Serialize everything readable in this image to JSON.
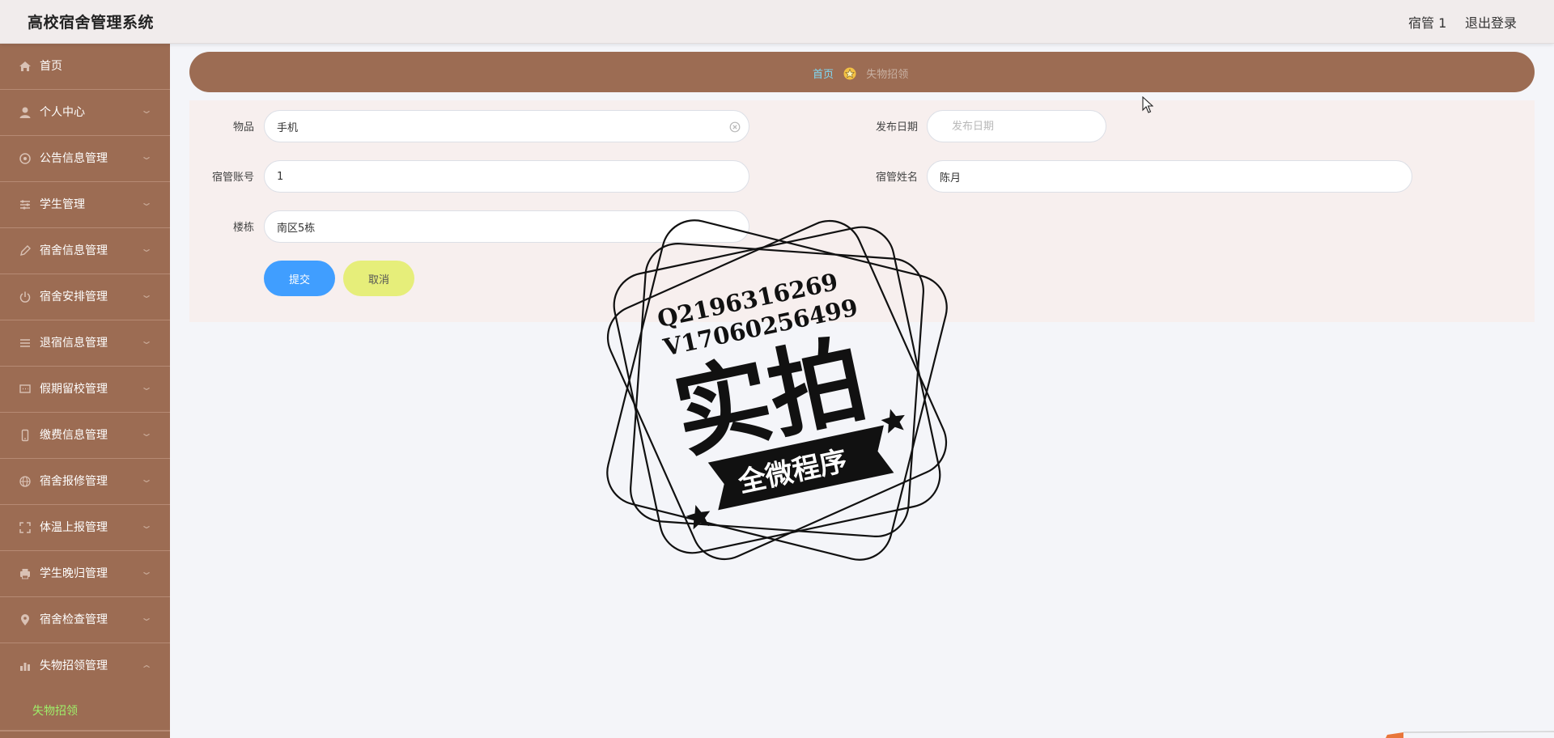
{
  "header": {
    "app_title": "高校宿舍管理系统",
    "user_name": "宿管 1",
    "logout_label": "退出登录"
  },
  "sidebar": {
    "items": [
      {
        "label": "首页",
        "icon": "home-icon",
        "has_arrow": false
      },
      {
        "label": "个人中心",
        "icon": "user-icon",
        "has_arrow": true
      },
      {
        "label": "公告信息管理",
        "icon": "bullhorn-icon",
        "has_arrow": true
      },
      {
        "label": "学生管理",
        "icon": "sliders-icon",
        "has_arrow": true
      },
      {
        "label": "宿舍信息管理",
        "icon": "edit-icon",
        "has_arrow": true
      },
      {
        "label": "宿舍安排管理",
        "icon": "power-icon",
        "has_arrow": true
      },
      {
        "label": "退宿信息管理",
        "icon": "list-icon",
        "has_arrow": true
      },
      {
        "label": "假期留校管理",
        "icon": "chat-icon",
        "has_arrow": true
      },
      {
        "label": "缴费信息管理",
        "icon": "mobile-icon",
        "has_arrow": true
      },
      {
        "label": "宿舍报修管理",
        "icon": "globe-icon",
        "has_arrow": true
      },
      {
        "label": "体温上报管理",
        "icon": "fullscreen-icon",
        "has_arrow": true
      },
      {
        "label": "学生晚归管理",
        "icon": "printer-icon",
        "has_arrow": true
      },
      {
        "label": "宿舍检查管理",
        "icon": "location-icon",
        "has_arrow": true
      },
      {
        "label": "失物招领管理",
        "icon": "bar-chart-icon",
        "has_arrow": true
      }
    ],
    "active_sub_item": "失物招领"
  },
  "breadcrumb": {
    "home": "首页",
    "current": "失物招领"
  },
  "form": {
    "item_label": "物品",
    "item_value": "手机",
    "date_label": "发布日期",
    "date_placeholder": "发布日期",
    "account_label": "宿管账号",
    "account_value": "1",
    "name_label": "宿管姓名",
    "name_value": "陈月",
    "building_label": "楼栋",
    "building_value": "南区5栋",
    "submit_label": "提交",
    "cancel_label": "取消"
  },
  "watermark": {
    "line1": "Q2196316269",
    "line2": "V17060256499",
    "main_text": "实拍",
    "banner_text": "全微程序"
  },
  "colors": {
    "sidebar_bg": "#9c6c53",
    "breadcrumb_home": "#7fd9f5",
    "submit_bg": "#409eff",
    "cancel_bg": "#e6ee7a",
    "active_sub_text": "#9ef16a"
  }
}
